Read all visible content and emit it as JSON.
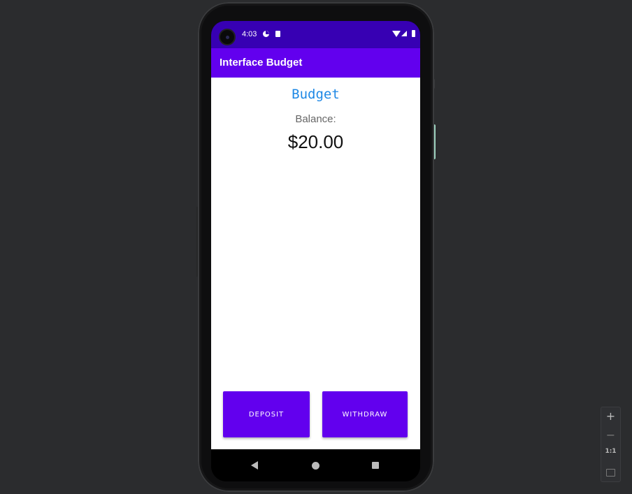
{
  "status_bar": {
    "time": "4:03"
  },
  "app_bar": {
    "title": "Interface Budget"
  },
  "main": {
    "heading": "Budget",
    "balance_label": "Balance:",
    "balance_value": "$20.00"
  },
  "buttons": {
    "deposit": "DEPOSIT",
    "withdraw": "WITHDRAW"
  },
  "zoom_controls": {
    "zoom_in": "+",
    "zoom_out": "−",
    "actual_size": "1:1"
  },
  "colors": {
    "status_bar": "#3700b3",
    "app_bar": "#6200ee",
    "heading": "#1e88e5",
    "button": "#6200ee"
  }
}
